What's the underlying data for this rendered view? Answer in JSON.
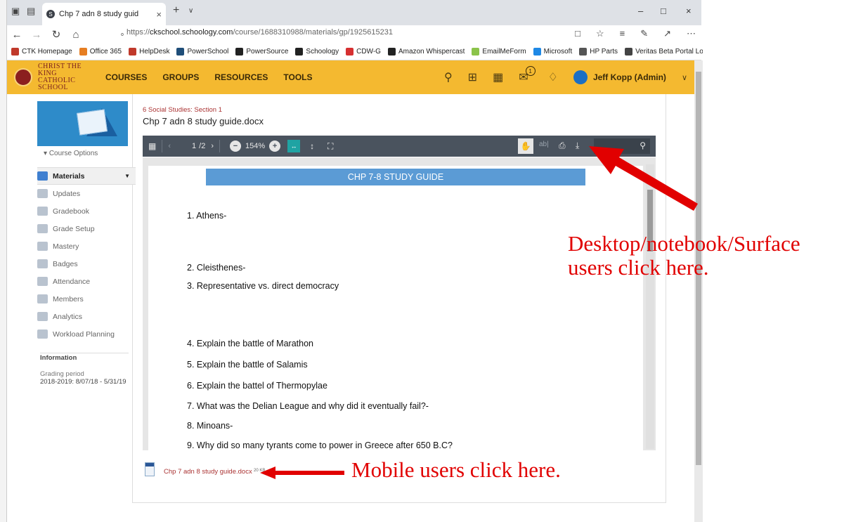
{
  "browser": {
    "tab_title": "Chp 7 adn 8 study guid",
    "url_prefix": "https://",
    "url_host": "ckschool.schoology.com",
    "url_path": "/course/1688310988/materials/gp/1925615231",
    "favorites": [
      {
        "label": "CTK Homepage",
        "color": "#c0392b"
      },
      {
        "label": "Office 365",
        "color": "#e67e22"
      },
      {
        "label": "HelpDesk",
        "color": "#c0392b"
      },
      {
        "label": "PowerSchool",
        "color": "#1f4e79"
      },
      {
        "label": "PowerSource",
        "color": "#222222"
      },
      {
        "label": "Schoology",
        "color": "#222222"
      },
      {
        "label": "CDW-G",
        "color": "#d63031"
      },
      {
        "label": "Amazon Whispercast",
        "color": "#222222"
      },
      {
        "label": "EmailMeForm",
        "color": "#8bc34a"
      },
      {
        "label": "Microsoft",
        "color": "#1e88e5"
      },
      {
        "label": "HP Parts",
        "color": "#555555"
      },
      {
        "label": "Veritas Beta Portal Lo",
        "color": "#444444"
      }
    ]
  },
  "header": {
    "school_line1": "CHRIST THE KING",
    "school_line2": "CATHOLIC SCHOOL",
    "nav": [
      "COURSES",
      "GROUPS",
      "RESOURCES",
      "TOOLS"
    ],
    "notification_count": "1",
    "user_name": "Jeff Kopp (Admin)",
    "accent_color": "#f4b930"
  },
  "sidebar": {
    "course_options": "Course Options",
    "items": [
      {
        "label": "Materials",
        "active": true
      },
      {
        "label": "Updates"
      },
      {
        "label": "Gradebook"
      },
      {
        "label": "Grade Setup"
      },
      {
        "label": "Mastery"
      },
      {
        "label": "Badges"
      },
      {
        "label": "Attendance"
      },
      {
        "label": "Members"
      },
      {
        "label": "Analytics"
      },
      {
        "label": "Workload Planning"
      }
    ],
    "info_heading": "Information",
    "grading_label": "Grading period",
    "grading_value": "2018-2019: 8/07/18 - 5/31/19"
  },
  "main": {
    "breadcrumb": "6 Social Studies: Section 1",
    "title": "Chp 7 adn 8 study guide.docx",
    "viewer": {
      "page_current": "1",
      "page_total": "/2",
      "zoom": "154%"
    },
    "document": {
      "heading": "CHP 7-8 STUDY GUIDE",
      "questions": [
        "1.  Athens-",
        "2.  Cleisthenes-",
        "3.  Representative vs. direct democracy",
        "4.  Explain the battle of Marathon",
        "5.  Explain the battle of Salamis",
        "6.  Explain the battel of Thermopylae",
        "7.  What was the Delian League and why did it eventually fail?-",
        "8.  Minoans-",
        "9.  Why did so many tyrants come to power in Greece after 650 B.C?"
      ]
    },
    "attachment": {
      "filename": "Chp 7 adn 8 study guide.docx",
      "meta": "20 KB"
    }
  },
  "annotations": {
    "desktop_line1": "Desktop/notebook/Surface",
    "desktop_line2": "users click here.",
    "mobile": "Mobile users click here.",
    "color": "#e10000"
  }
}
